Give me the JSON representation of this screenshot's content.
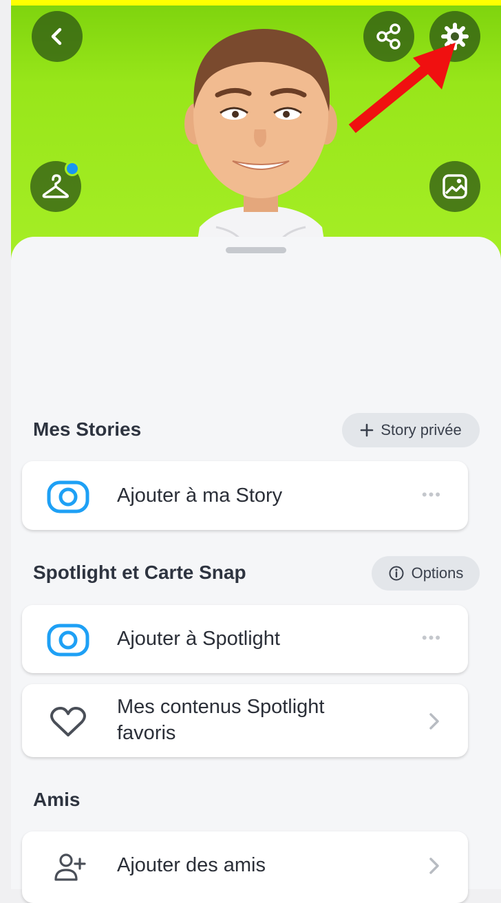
{
  "header": {
    "back_icon": "chevron-left-icon",
    "share_icon": "share-icon",
    "settings_icon": "gear-icon",
    "wardrobe_icon": "hanger-icon",
    "gallery_icon": "image-icon",
    "annotation": "red-arrow"
  },
  "stories": {
    "title": "Mes Stories",
    "pill_label": "Story privée",
    "pill_icon": "plus-icon",
    "add_story_label": "Ajouter à ma Story"
  },
  "spotlight": {
    "title": "Spotlight et Carte Snap",
    "pill_label": "Options",
    "pill_icon": "info-icon",
    "add_spotlight_label": "Ajouter à Spotlight",
    "favorites_label_line1": "Mes contenus Spotlight",
    "favorites_label_line2": "favoris"
  },
  "friends": {
    "title": "Amis",
    "add_friends_label": "Ajouter des amis"
  },
  "colors": {
    "header_green": "#a6ee26",
    "camera_blue": "#1ea0f5",
    "arrow_red": "#f01010",
    "frame_yellow": "#ffff00"
  }
}
